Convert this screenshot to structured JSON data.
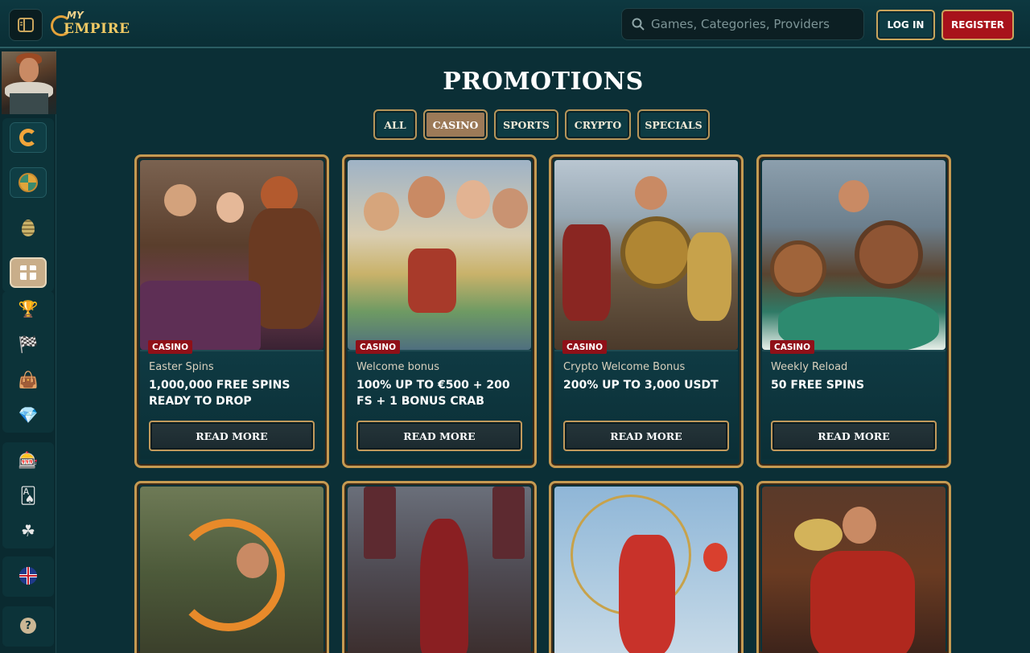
{
  "header": {
    "logo_top": "MY",
    "logo_bottom": "EMPIRE",
    "search_placeholder": "Games, Categories, Providers",
    "login_label": "LOG IN",
    "register_label": "REGISTER"
  },
  "sidebar": {
    "items": [
      {
        "icon": "casino-c-icon"
      },
      {
        "icon": "wheel-icon"
      },
      {
        "icon": "easter-egg-icon"
      },
      {
        "icon": "gift-icon",
        "active": true
      },
      {
        "icon": "trophy-icon"
      },
      {
        "icon": "race-flag-icon"
      },
      {
        "icon": "shop-bag-icon"
      },
      {
        "icon": "diamond-icon"
      },
      {
        "icon": "slot-machine-icon"
      },
      {
        "icon": "cards-icon"
      },
      {
        "icon": "clover-icon"
      },
      {
        "icon": "uk-flag-icon"
      },
      {
        "icon": "help-icon"
      }
    ],
    "help_glyph": "?"
  },
  "main": {
    "title": "PROMOTIONS",
    "tabs": [
      {
        "label": "ALL",
        "active": false
      },
      {
        "label": "CASINO",
        "active": true
      },
      {
        "label": "SPORTS",
        "active": false
      },
      {
        "label": "CRYPTO",
        "active": false
      },
      {
        "label": "SPECIALS",
        "active": false
      }
    ],
    "cards": [
      {
        "badge": "CASINO",
        "subtitle": "Easter Spins",
        "title": "1,000,000 FREE SPINS READY TO DROP",
        "button": "READ MORE"
      },
      {
        "badge": "CASINO",
        "subtitle": "Welcome bonus",
        "title": "100% UP TO €500 + 200 FS + 1 BONUS CRAB",
        "button": "READ MORE"
      },
      {
        "badge": "CASINO",
        "subtitle": "Crypto Welcome Bonus",
        "title": "200% UP TO 3,000 USDT",
        "button": "READ MORE"
      },
      {
        "badge": "CASINO",
        "subtitle": "Weekly Reload",
        "title": "50 FREE SPINS",
        "button": "READ MORE"
      }
    ]
  },
  "colors": {
    "background": "#0b2f36",
    "gold_border": "#c59a52",
    "register_red": "#a8121b",
    "badge_red": "#8f1018",
    "active_tab": "#9c7a58"
  }
}
